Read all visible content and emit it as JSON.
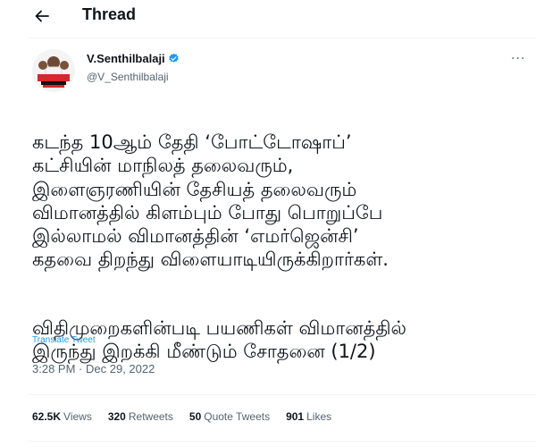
{
  "header": {
    "title": "Thread"
  },
  "author": {
    "name": "V.Senthilbalaji",
    "handle": "@V_Senthilbalaji",
    "verified_color": "#1d9bf0"
  },
  "tweet": {
    "paragraph1": "கடந்த 10ஆம் தேதி ‘போட்டோஷாப்’\nகட்சியின் மாநிலத் தலைவரும்,\nஇளைஞரணியின் தேசியத் தலைவரும்\nவிமானத்தில் கிளம்பும் போது பொறுப்பே\nஇல்லாமல் விமானத்தின் ‘எமர்ஜென்சி’\nகதவை திறந்து விளையாடியிருக்கிறார்கள்.",
    "paragraph2": "விதிமுறைகளின்படி பயணிகள் விமானத்தில்\nஇருந்து இறக்கி மீண்டும் சோதனை (1/2)",
    "translate_label": "Translate Tweet",
    "time": "3:28 PM",
    "date": "Dec 29, 2022"
  },
  "stats": {
    "views_count": "62.5K",
    "views_label": "Views",
    "retweets_count": "320",
    "retweets_label": "Retweets",
    "quotes_count": "50",
    "quotes_label": "Quote Tweets",
    "likes_count": "901",
    "likes_label": "Likes"
  }
}
